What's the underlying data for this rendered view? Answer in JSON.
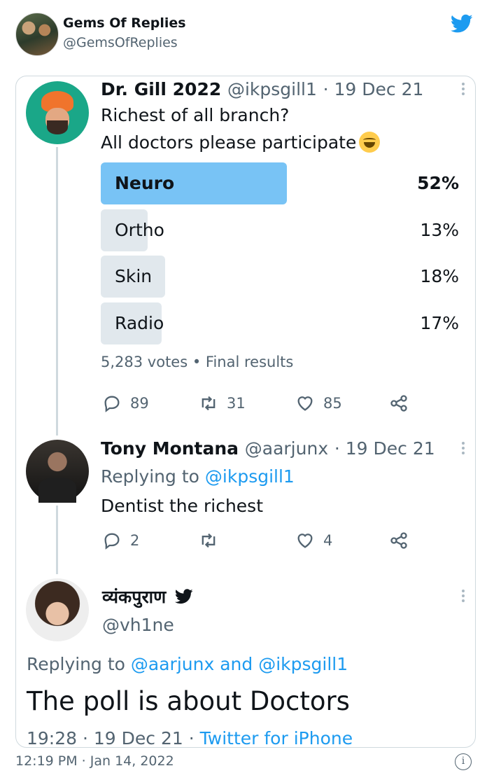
{
  "account": {
    "name": "Gems Of Replies",
    "handle": "@GemsOfReplies"
  },
  "tweet1": {
    "name": "Dr. Gill 2022",
    "handle": "@ikpsgill1",
    "date": "· 19 Dec 21",
    "line1": "Richest of all branch?",
    "line2": "All doctors please participate",
    "poll": {
      "options": [
        {
          "label": "Neuro",
          "pct": "52%",
          "value": 52,
          "winner": true
        },
        {
          "label": "Ortho",
          "pct": "13%",
          "value": 13,
          "winner": false
        },
        {
          "label": "Skin",
          "pct": "18%",
          "value": 18,
          "winner": false
        },
        {
          "label": "Radio",
          "pct": "17%",
          "value": 17,
          "winner": false
        }
      ],
      "summary": "5,283 votes • Final results"
    },
    "actions": {
      "replies": "89",
      "retweets": "31",
      "likes": "85"
    }
  },
  "tweet2": {
    "name": "Tony Montana",
    "handle": "@aarjunx",
    "date": "· 19 Dec 21",
    "replying_prefix": "Replying to",
    "replying_to": "@ikpsgill1",
    "text": "Dentist the richest",
    "actions": {
      "replies": "2",
      "retweets": "",
      "likes": "4"
    }
  },
  "tweet3": {
    "name": "व्यंकपुराण",
    "handle": "@vh1ne",
    "replying_prefix": "Replying to",
    "replying_to_1": "@aarjunx",
    "and": "and",
    "replying_to_2": "@ikpsgill1",
    "text": "The poll is about Doctors",
    "time": "19:28 · 19 Dec 21 ·",
    "source": "Twitter for iPhone"
  },
  "footer": {
    "timestamp": "12:19 PM · Jan 14, 2022"
  },
  "colors": {
    "accent": "#1d9bf0",
    "poll_winner": "#78c3f5",
    "poll_other": "#e1e8ed",
    "muted": "#536471"
  }
}
